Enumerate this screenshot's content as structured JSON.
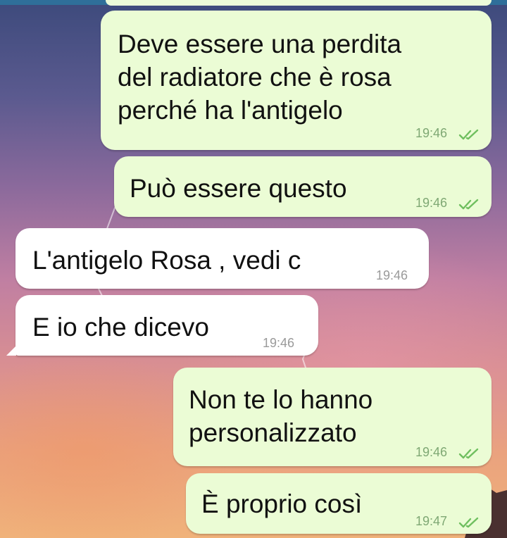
{
  "chat": {
    "messages": [
      {
        "direction": "outgoing",
        "lines": [
          "Deve essere una perdita",
          "del radiatore che è rosa",
          "perché ha l'antigelo"
        ],
        "time": "19:46",
        "status": "read"
      },
      {
        "direction": "outgoing",
        "lines": [
          "Può essere questo"
        ],
        "time": "19:46",
        "status": "read"
      },
      {
        "direction": "incoming",
        "lines": [
          "L'antigelo Rosa , vedi c"
        ],
        "time": "19:46"
      },
      {
        "direction": "incoming",
        "lines": [
          "E io che dicevo"
        ],
        "time": "19:46"
      },
      {
        "direction": "outgoing",
        "lines": [
          "Non te lo hanno",
          "personalizzato"
        ],
        "time": "19:46",
        "status": "read"
      },
      {
        "direction": "outgoing",
        "lines": [
          "È proprio così"
        ],
        "time": "19:47",
        "status": "read"
      }
    ]
  },
  "colors": {
    "outgoing_bubble": "#ebfcd5",
    "incoming_bubble": "#ffffff",
    "read_ticks": "#6fbf5f"
  },
  "icons": {
    "read_receipt": "double-check-icon"
  }
}
